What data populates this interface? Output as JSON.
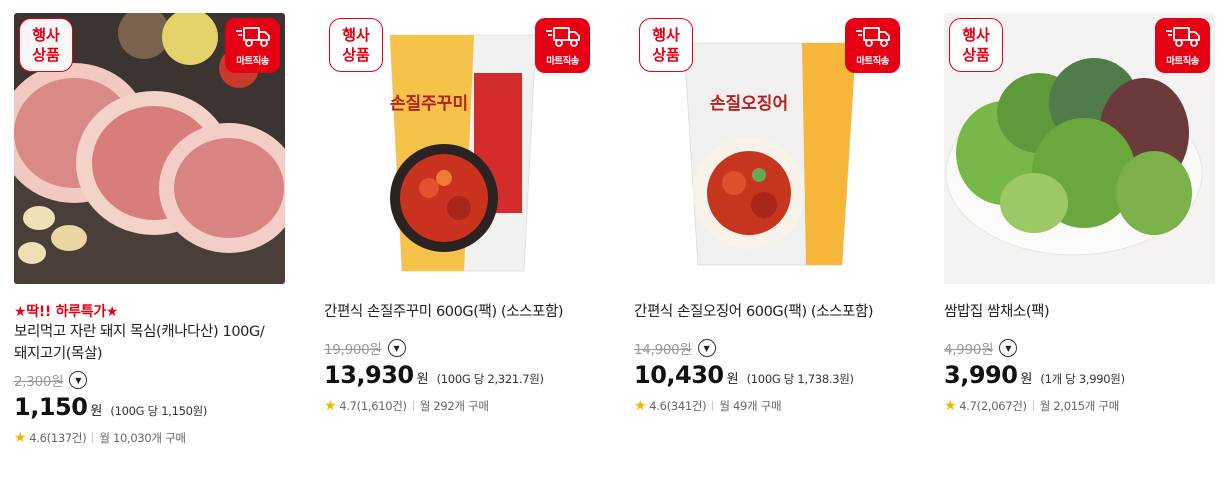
{
  "badges": {
    "event_line1": "행사",
    "event_line2": "상품",
    "delivery": "마트직송",
    "delivery_icon": "truck-icon"
  },
  "products": [
    {
      "promo": "★딱!! 하루특가★",
      "title_lines": [
        "보리먹고 자란 돼지 목심(캐나다산) 100G/",
        "돼지고기(목살)"
      ],
      "original_price": "2,300원",
      "price": "1,150",
      "won": "원",
      "unit_price": "(100G 당 1,150원)",
      "rating": "4.6",
      "reviews": "(137건)",
      "purchases": "월 10,030개 구매"
    },
    {
      "promo": "",
      "title_lines": [
        "간편식 손질주꾸미 600G(팩) (소스포함)"
      ],
      "original_price": "19,900원",
      "price": "13,930",
      "won": "원",
      "unit_price": "(100G 당 2,321.7원)",
      "rating": "4.7",
      "reviews": "(1,610건)",
      "purchases": "월 292개 구매"
    },
    {
      "promo": "",
      "title_lines": [
        "간편식 손질오징어 600G(팩) (소스포함)"
      ],
      "original_price": "14,900원",
      "price": "10,430",
      "won": "원",
      "unit_price": "(100G 당 1,738.3원)",
      "rating": "4.6",
      "reviews": "(341건)",
      "purchases": "월 49개 구매"
    },
    {
      "promo": "",
      "title_lines": [
        "쌈밥집 쌈채소(팩)"
      ],
      "original_price": "4,990원",
      "price": "3,990",
      "won": "원",
      "unit_price": "(1개 당 3,990원)",
      "rating": "4.7",
      "reviews": "(2,067건)",
      "purchases": "월 2,015개 구매"
    }
  ],
  "package_labels": {
    "jukkumi": "손질주꾸미",
    "squid": "손질오징어"
  },
  "colors": {
    "accent": "#e60013",
    "star": "#f7b500"
  }
}
